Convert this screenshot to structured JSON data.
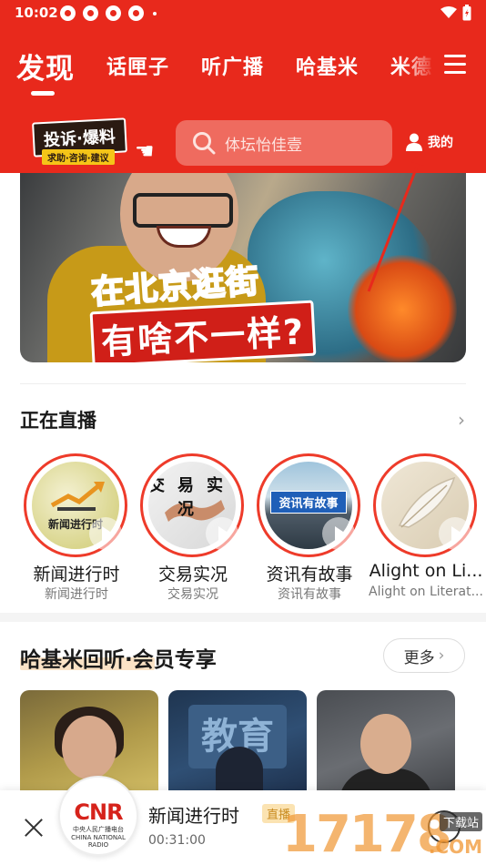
{
  "status_bar": {
    "time": "10:02"
  },
  "tabs": [
    {
      "label": "发现",
      "active": true
    },
    {
      "label": "话匣子",
      "active": false
    },
    {
      "label": "听广播",
      "active": false
    },
    {
      "label": "哈基米",
      "active": false
    },
    {
      "label": "米德",
      "active": false
    }
  ],
  "report_badge": {
    "main": "投诉·爆料",
    "sub": "求助·咨询·建议"
  },
  "search": {
    "placeholder": "体坛怡佳壹"
  },
  "mine": {
    "label": "我的"
  },
  "banner": {
    "line1": "在北京逛街",
    "line2": "有啥不一样?"
  },
  "live_section": {
    "title": "正在直播",
    "items": [
      {
        "name": "新闻进行时",
        "subtitle": "新闻进行时",
        "cover_text": "新闻进行时"
      },
      {
        "name": "交易实况",
        "subtitle": "交易实况",
        "cover_text": "交易实况"
      },
      {
        "name": "资讯有故事",
        "subtitle": "资讯有故事",
        "cover_text": "资讯有故事"
      },
      {
        "name": "Alight on Li...",
        "subtitle": "Alight on Literat...",
        "cover_text": ""
      }
    ]
  },
  "member_section": {
    "title": "哈基米回听·会员专享",
    "more_label": "更多",
    "thumb2_text": "教育"
  },
  "player": {
    "logo_text": "CNR",
    "logo_subtext": "中央人民广播电台 CHINA NATIONAL RADIO",
    "title": "新闻进行时",
    "badge": "直播",
    "time": "00:31:00"
  },
  "watermark": {
    "number": "17178",
    "site": "下载站",
    "suffix": ".COM"
  },
  "colors": {
    "brand_red": "#e8291c",
    "live_ring": "#ee3b2a",
    "badge_bg": "#fbe3b2"
  }
}
